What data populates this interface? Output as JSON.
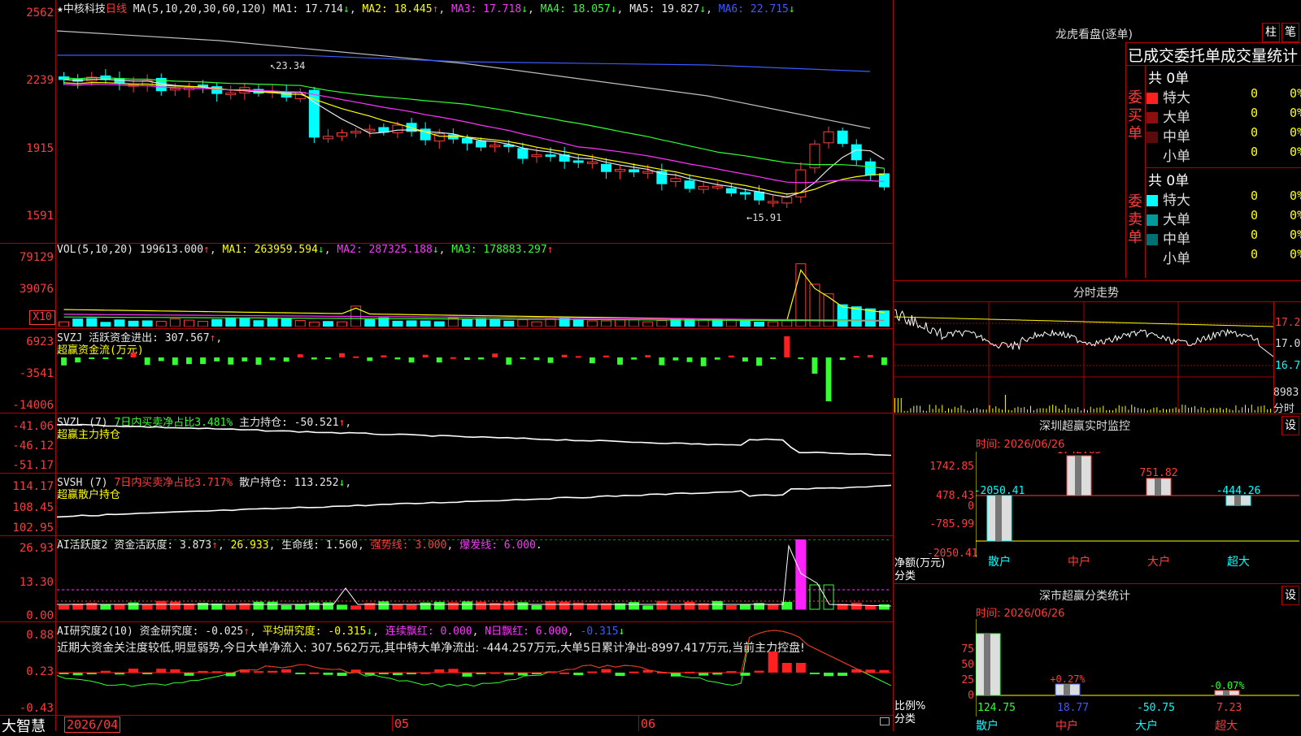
{
  "kline": {
    "name": "中核科技",
    "period": "日线",
    "ma_spec": "MA(5,10,20,30,60,120)",
    "ma1": "MA1: 17.714",
    "ma2": "MA2: 18.445",
    "ma3": "MA3: 17.718",
    "ma4": "MA4: 18.057",
    "ma5": "MA5: 19.827",
    "ma6": "MA6: 22.715",
    "axis": [
      "2562",
      "2239",
      "1915",
      "1591"
    ],
    "high_mark": "23.34",
    "low_mark": "15.91",
    "colors": {
      "up": "#ff3b3b",
      "down": "#00ffff",
      "ma1": "#e8e8e8",
      "ma2": "#ffff00",
      "ma3": "#ff33ff",
      "ma4": "#33ff33",
      "ma5": "#c0c0c0",
      "ma6": "#3b5bff"
    }
  },
  "vol": {
    "label": "VOL(5,10,20)",
    "value": "199613.000",
    "ma1": "MA1: 263959.594",
    "ma2": "MA2: 287325.188",
    "ma3": "MA3: 178883.297",
    "axis": [
      "79129",
      "39076"
    ],
    "unit": "X10"
  },
  "svzj": {
    "label": "SVZJ",
    "indicator": "活跃资金进出: 307.567",
    "sub": "超赢资金流(万元)",
    "axis": [
      "6923",
      "-3541",
      "-14006"
    ]
  },
  "svzl": {
    "label": "SVZL (7)",
    "ratio": "7日内买卖净占比3.481%",
    "main": "主力持仓: -50.521",
    "sub": "超赢主力持仓",
    "axis": [
      "-41.06",
      "-46.12",
      "-51.17"
    ]
  },
  "svsh": {
    "label": "SVSH (7)",
    "ratio": "7日内买卖净占比3.717%",
    "retail": "散户持仓: 113.252",
    "sub": "超赢散户持仓",
    "axis": [
      "114.17",
      "108.45",
      "102.95"
    ]
  },
  "ai_active": {
    "label": "AI活跃度2",
    "activity": "资金活跃度: 3.873",
    "v2": "26.933",
    "life": "生命线: 1.560",
    "strong": "强势线: 3.000",
    "burst": "爆发线: 6.000",
    "axis": [
      "26.93",
      "13.30",
      "0.00"
    ]
  },
  "ai_research": {
    "label": "AI研究度2(10)",
    "research": "资金研究度: -0.025",
    "avg": "平均研究度: -0.315",
    "cont": "连续飘红: 0.000",
    "nday": "N日飘红: 6.000",
    "last": "-0.315",
    "comment": "近期大资金关注度较低,明显弱势,今日大单净流入: 307.562万元,其中特大单净流出: -444.257万元,大单5日累计净出-8997.417万元,当前主力控盘!",
    "axis": [
      "0.88",
      "0.23",
      "-0.43"
    ]
  },
  "footer": {
    "brand": "大智慧",
    "date": "2026/04",
    "m05": "05",
    "m06": "06"
  },
  "dragon": {
    "title": "龙虎看盘(逐单)",
    "btn1": "柱",
    "btn2": "笔",
    "subtitle": "已成交委托单成交量统计",
    "buy_label": "委买单",
    "sell_label": "委卖单",
    "buy_total": "共 0单",
    "sell_total": "共 0单",
    "buy_rows": [
      {
        "name": "特大",
        "count": "0",
        "pct": "0%",
        "color": "#ff2020"
      },
      {
        "name": "大单",
        "count": "0",
        "pct": "0%",
        "color": "#8a1010"
      },
      {
        "name": "中单",
        "count": "0",
        "pct": "0%",
        "color": "#5a0c0c"
      },
      {
        "name": "小单",
        "count": "0",
        "pct": "0%",
        "color": "#000000"
      }
    ],
    "sell_rows": [
      {
        "name": "特大",
        "count": "0",
        "pct": "0%",
        "color": "#00ffff"
      },
      {
        "name": "大单",
        "count": "0",
        "pct": "0%",
        "color": "#009a9a"
      },
      {
        "name": "中单",
        "count": "0",
        "pct": "0%",
        "color": "#007070"
      },
      {
        "name": "小单",
        "count": "0",
        "pct": "0%",
        "color": "#000000"
      }
    ]
  },
  "intraday": {
    "title": "分时走势",
    "prices": [
      "17.22",
      "17.00",
      "16.78"
    ],
    "vol_value": "8983",
    "vol_label": "分时"
  },
  "monitor": {
    "title": "深圳超赢实时监控",
    "setting": "设",
    "time": "时间: 2026/06/26",
    "axis": [
      "1742.85",
      "478.43",
      "0",
      "-785.99",
      "-2050.41"
    ],
    "ylabel": "净额(万元)",
    "xlabel": "分类",
    "cats": [
      "散户",
      "中户",
      "大户",
      "超大"
    ],
    "values": [
      -2050.41,
      1742.85,
      751.82,
      -444.26
    ],
    "labels": [
      "-2050.41",
      "1742.85",
      "751.82",
      "-444.26"
    ]
  },
  "classify": {
    "title": "深市超赢分类统计",
    "setting": "设",
    "time": "时间: 2026/06/26",
    "axis": [
      "75",
      "50",
      "25",
      "0"
    ],
    "ylabel": "比例%",
    "xlabel": "分类",
    "cats": [
      "散户",
      "中户",
      "大户",
      "超大"
    ],
    "values": [
      124.75,
      18.77,
      -50.75,
      7.23
    ],
    "pct_labels": [
      "",
      "+0.27%",
      "",
      "-0.07%"
    ],
    "labels": [
      "124.75",
      "18.77",
      "-50.75",
      "7.23"
    ]
  }
}
